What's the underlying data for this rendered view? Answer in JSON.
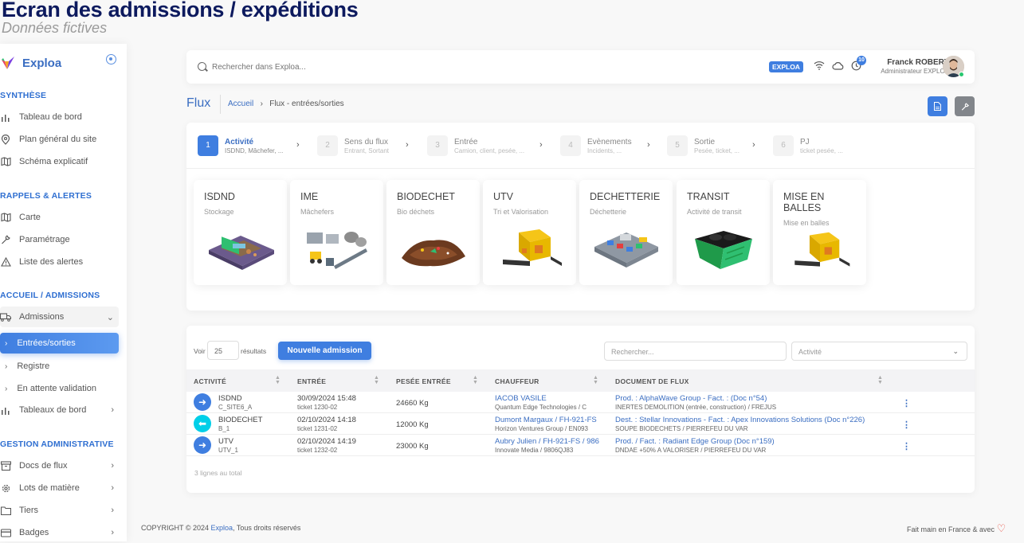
{
  "banner": {
    "title": "Ecran des admissions / expéditions",
    "subtitle": "Données fictives"
  },
  "sidebar": {
    "brand": "Exploa",
    "sections": {
      "synthese": "SYNTHÈSE",
      "rappels": "RAPPELS & ALERTES",
      "accueil": "ACCUEIL / ADMISSIONS",
      "gestion": "GESTION ADMINISTRATIVE"
    },
    "items": {
      "tableau": "Tableau de bord",
      "plan": "Plan général du site",
      "schema": "Schéma explicatif",
      "carte": "Carte",
      "parametrage": "Paramétrage",
      "alertes": "Liste des alertes",
      "admissions": "Admissions",
      "entrees": "Entrées/sorties",
      "registre": "Registre",
      "attente": "En attente validation",
      "tableaux": "Tableaux de bord",
      "docs": "Docs de flux",
      "lots": "Lots de matière",
      "tiers": "Tiers",
      "badges": "Badges"
    }
  },
  "header": {
    "search_placeholder": "Rechercher dans Exploa...",
    "badge": "EXPLOA",
    "notifications": "10",
    "user_name": "Franck ROBERT",
    "user_role": "Administrateur EXPLOA"
  },
  "page": {
    "title": "Flux",
    "breadcrumb_home": "Accueil",
    "breadcrumb_current": "Flux - entrées/sorties"
  },
  "steps": [
    {
      "num": "1",
      "title": "Activité",
      "sub": "ISDND, Mâchefer, ..."
    },
    {
      "num": "2",
      "title": "Sens du flux",
      "sub": "Entrant, Sortant"
    },
    {
      "num": "3",
      "title": "Entrée",
      "sub": "Camion, client, pesée, ..."
    },
    {
      "num": "4",
      "title": "Evènements",
      "sub": "Incidents, ..."
    },
    {
      "num": "5",
      "title": "Sortie",
      "sub": "Pesée, ticket, ..."
    },
    {
      "num": "6",
      "title": "PJ",
      "sub": "ticket pesée, ..."
    }
  ],
  "activities": [
    {
      "title": "ISDND",
      "desc": "Stockage"
    },
    {
      "title": "IME",
      "desc": "Mâchefers"
    },
    {
      "title": "BIODECHET",
      "desc": "Bio déchets"
    },
    {
      "title": "UTV",
      "desc": "Tri et Valorisation"
    },
    {
      "title": "DECHETTERIE",
      "desc": "Déchetterie"
    },
    {
      "title": "TRANSIT",
      "desc": "Activité de transit"
    },
    {
      "title": "MISE EN BALLES",
      "desc": "Mise en balles"
    }
  ],
  "table": {
    "show_label": "Voir",
    "page_length": "25",
    "results_label": "résultats",
    "new_button": "Nouvelle admission",
    "search_placeholder": "Rechercher...",
    "activity_filter": "Activité",
    "columns": [
      "ACTIVITÉ",
      "ENTRÉE",
      "PESÉE ENTRÉE",
      "CHAUFFEUR",
      "DOCUMENT DE FLUX"
    ],
    "rows": [
      {
        "dir": "in",
        "act": "ISDND",
        "act_sub": "C_SITE6_A",
        "date": "30/09/2024 15:48",
        "ticket": "ticket 1230-02",
        "weight": "24660 Kg",
        "driver": "IACOB VASILE",
        "company": "Quantum Edge Technologies / C",
        "doc": "Prod. : AlphaWave Group - Fact. : (Doc n°54)",
        "doc_sub": "INERTES DEMOLITION (entrée, construction) / FREJUS"
      },
      {
        "dir": "out",
        "act": "BIODECHET",
        "act_sub": "B_1",
        "date": "02/10/2024 14:18",
        "ticket": "ticket 1231-02",
        "weight": "12000 Kg",
        "driver": "Dumont Margaux / FH-921-FS",
        "company": "Horizon Ventures Group / EN093",
        "doc": "Dest. : Stellar Innovations - Fact. : Apex Innovations Solutions (Doc n°226)",
        "doc_sub": "SOUPE BIODECHETS / PIERREFEU DU VAR"
      },
      {
        "dir": "in",
        "act": "UTV",
        "act_sub": "UTV_1",
        "date": "02/10/2024 14:19",
        "ticket": "ticket 1232-02",
        "weight": "23000 Kg",
        "driver": "Aubry Julien / FH-921-FS / 986",
        "company": "Innovate Media / 9806QJ83",
        "doc": "Prod. / Fact. : Radiant Edge Group (Doc n°159)",
        "doc_sub": "DNDAE +50% A VALORISER / PIERREFEU DU VAR"
      }
    ],
    "total": "3 lignes au total"
  },
  "footer": {
    "copyright": "COPYRIGHT © 2024",
    "brand": "Exploa",
    "rights": ", Tous droits réservés",
    "made": "Fait main en France & avec"
  },
  "colors": {
    "accent": "#3f7ee0",
    "cyan": "#00cfe8",
    "dark": "#82868b"
  }
}
